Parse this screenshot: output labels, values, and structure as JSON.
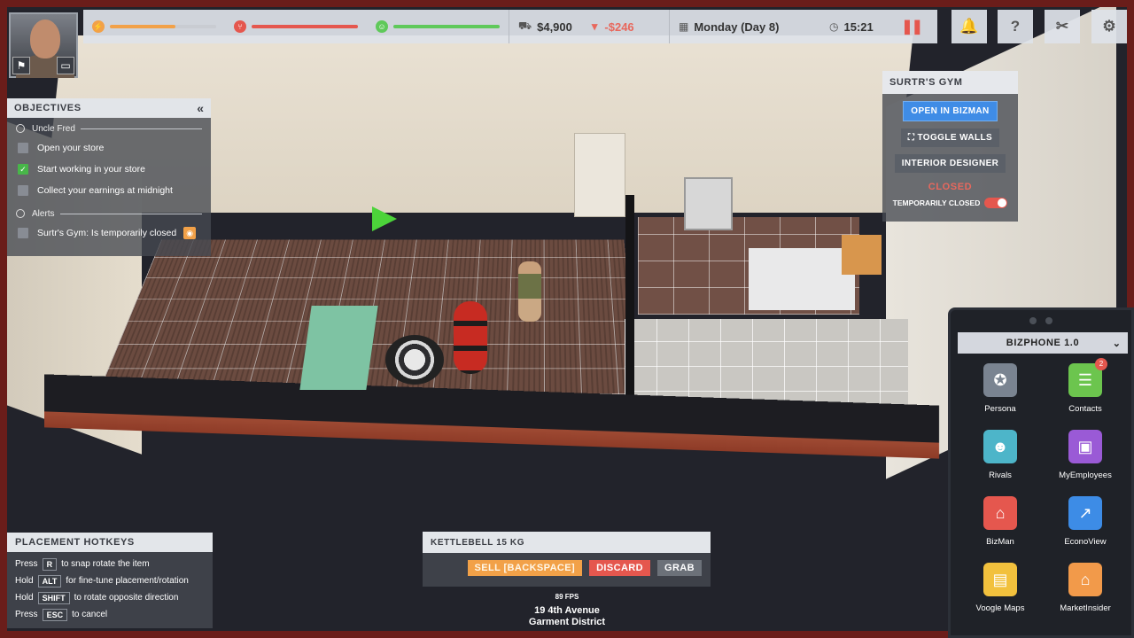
{
  "hud": {
    "energy": 0.62,
    "hunger": 1.0,
    "happiness": 1.0,
    "money": "$4,900",
    "money_change": "-$246",
    "date": "Monday (Day 8)",
    "time": "15:21",
    "colors": {
      "energy": "#f2a148",
      "hunger": "#e5574e",
      "happiness": "#5fc95a"
    }
  },
  "top_buttons": [
    {
      "name": "notifications-button",
      "icon": "bell-icon",
      "glyph": "🔔"
    },
    {
      "name": "help-button",
      "icon": "question-icon",
      "glyph": "?"
    },
    {
      "name": "build-mode-button",
      "icon": "build-icon",
      "glyph": "✂"
    },
    {
      "name": "settings-button",
      "icon": "gear-icon",
      "glyph": "⚙"
    }
  ],
  "objectives": {
    "title": "OBJECTIVES",
    "collapse_glyph": "«",
    "groups": [
      {
        "title": "Uncle Fred",
        "items": [
          {
            "label": "Open your store",
            "done": false
          },
          {
            "label": "Start working in your store",
            "done": true
          },
          {
            "label": "Collect your earnings at midnight",
            "done": false
          }
        ]
      },
      {
        "title": "Alerts",
        "items": [
          {
            "label": "Surtr's Gym: Is temporarily closed",
            "done": false
          }
        ]
      }
    ]
  },
  "store": {
    "title": "SURTR'S GYM",
    "open_bizman": "OPEN IN BIZMAN",
    "toggle_walls": "TOGGLE WALLS",
    "interior_designer": "INTERIOR DESIGNER",
    "status": "CLOSED",
    "temporarily_closed": "TEMPORARILY CLOSED"
  },
  "phone": {
    "title": "BIZPHONE 1.0",
    "apps": [
      {
        "name": "Persona",
        "icon": "persona-icon",
        "glyph": "✪",
        "color": "#7a8491",
        "badge": ""
      },
      {
        "name": "Contacts",
        "icon": "chat-icon",
        "glyph": "☰",
        "color": "#6cc54e",
        "badge": "2"
      },
      {
        "name": "Rivals",
        "icon": "group-icon",
        "glyph": "☻",
        "color": "#4db5c9",
        "badge": ""
      },
      {
        "name": "MyEmployees",
        "icon": "badge-icon",
        "glyph": "▣",
        "color": "#9a5ad6",
        "badge": ""
      },
      {
        "name": "BizMan",
        "icon": "store-icon",
        "glyph": "⌂",
        "color": "#e5574e",
        "badge": ""
      },
      {
        "name": "EconoView",
        "icon": "chart-icon",
        "glyph": "↗",
        "color": "#3d8ce6",
        "badge": ""
      },
      {
        "name": "Voogle Maps",
        "icon": "map-icon",
        "glyph": "▤",
        "color": "#f2c13d",
        "badge": ""
      },
      {
        "name": "MarketInsider",
        "icon": "house-icon",
        "glyph": "⌂",
        "color": "#f29a4a",
        "badge": ""
      }
    ]
  },
  "hotkeys": {
    "title": "PLACEMENT HOTKEYS",
    "rows": [
      {
        "pre": "Press",
        "key": "R",
        "post": "to snap rotate the item"
      },
      {
        "pre": "Hold",
        "key": "ALT",
        "post": "for fine-tune placement/rotation"
      },
      {
        "pre": "Hold",
        "key": "SHIFT",
        "post": "to rotate opposite direction"
      },
      {
        "pre": "Press",
        "key": "ESC",
        "post": "to cancel"
      }
    ]
  },
  "item": {
    "title": "KETTLEBELL 15 KG",
    "sell": "SELL [BACKSPACE]",
    "discard": "DISCARD",
    "grab": "GRAB"
  },
  "footer": {
    "fps": "89 FPS",
    "address_line1": "19 4th Avenue",
    "address_line2": "Garment District"
  }
}
